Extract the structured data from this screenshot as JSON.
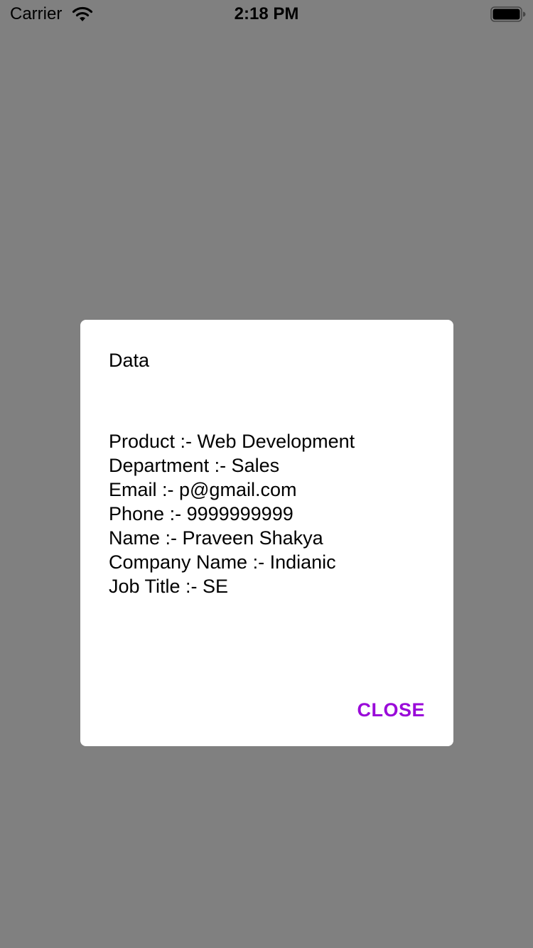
{
  "status_bar": {
    "carrier": "Carrier",
    "time": "2:18 PM",
    "wifi_icon": "wifi-icon",
    "battery_icon": "battery-icon"
  },
  "dialog": {
    "title": "Data",
    "lines": [
      "Product :- Web Development",
      "Department :- Sales",
      "Email :- p@gmail.com",
      "Phone :- 9999999999",
      "Name :- Praveen Shakya",
      "Company Name :- Indianic",
      "Job Title :- SE"
    ],
    "close_label": "CLOSE"
  },
  "colors": {
    "backdrop": "#808080",
    "dialog_background": "#ffffff",
    "accent": "#9a0ad9",
    "text": "#000000"
  }
}
